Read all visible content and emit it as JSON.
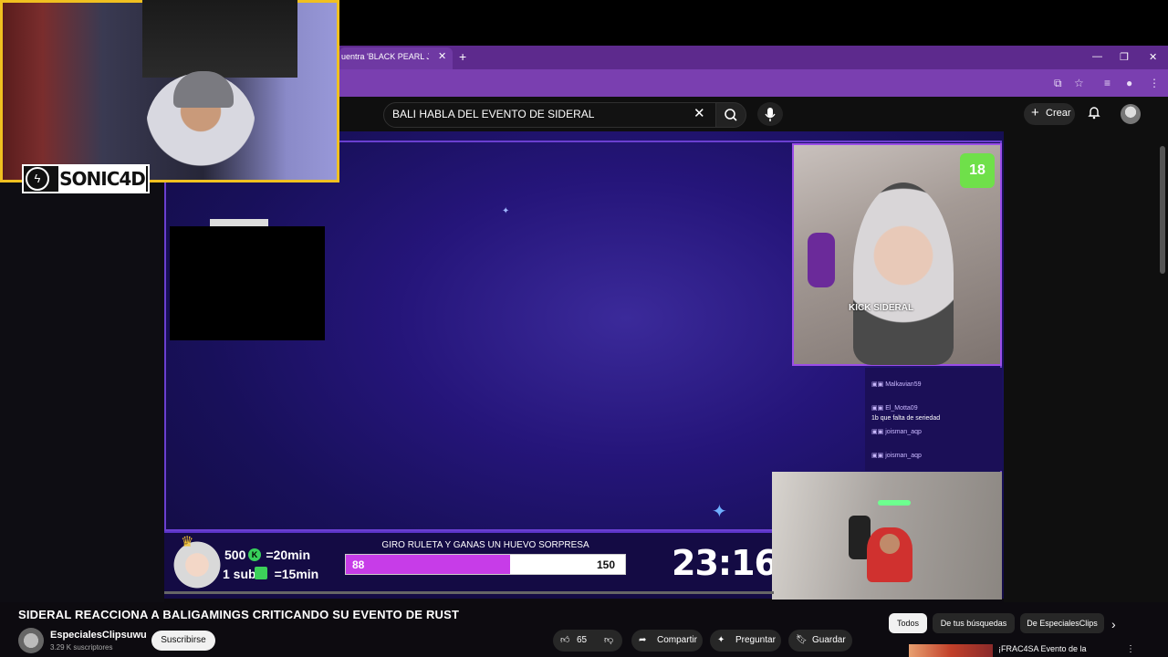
{
  "browser": {
    "tab_title": "uentra 'BLACK PEARL JAM'",
    "tab_close": "✕",
    "new_tab": "+",
    "window_minimize": "—",
    "window_maximize": "❐",
    "window_close": "✕"
  },
  "youtube_header": {
    "search_value": "BALI HABLA DEL EVENTO DE SIDERAL",
    "search_clear": "✕",
    "create_label": "Crear"
  },
  "webcam_overlay": {
    "logo_text": "SONIC4D"
  },
  "stream": {
    "kick_tag": "KICK SIDERAL",
    "age_badge": "18",
    "chat": [
      {
        "user": "Malkavian59",
        "text": ""
      },
      {
        "user": "El_Motta09",
        "text": ""
      },
      {
        "user": "",
        "text": "1b que falta de seriedad"
      },
      {
        "user": "joisman_aqp",
        "text": ""
      },
      {
        "user": "joisman_aqp",
        "text": ""
      }
    ],
    "reward_line1": "500",
    "reward_line1_suffix": "=20min",
    "reward_line2": "1 sub",
    "reward_line2_suffix": "=15min",
    "giro_title": "GIRO RULETA Y GANAS UN HUEVO SORPRESA",
    "progress_current": "88",
    "progress_goal": "150",
    "progress_fraction": 0.587,
    "timer": "23:16"
  },
  "video_info": {
    "title": "SIDERAL REACCIONA A BALIGAMINGS CRITICANDO SU EVENTO DE RUST",
    "channel_name": "EspecialesClipsuwu",
    "subscribers": "3.29 K suscriptores",
    "subscribe_label": "Suscribirse",
    "likes": "65",
    "share_label": "Compartir",
    "ask_label": "Preguntar",
    "save_label": "Guardar"
  },
  "chips": {
    "all": "Todos",
    "from_searches": "De tus búsquedas",
    "from_channel": "De EspecialesClips"
  },
  "recommended": {
    "title": "¡FRAC4SA Evento de la"
  }
}
